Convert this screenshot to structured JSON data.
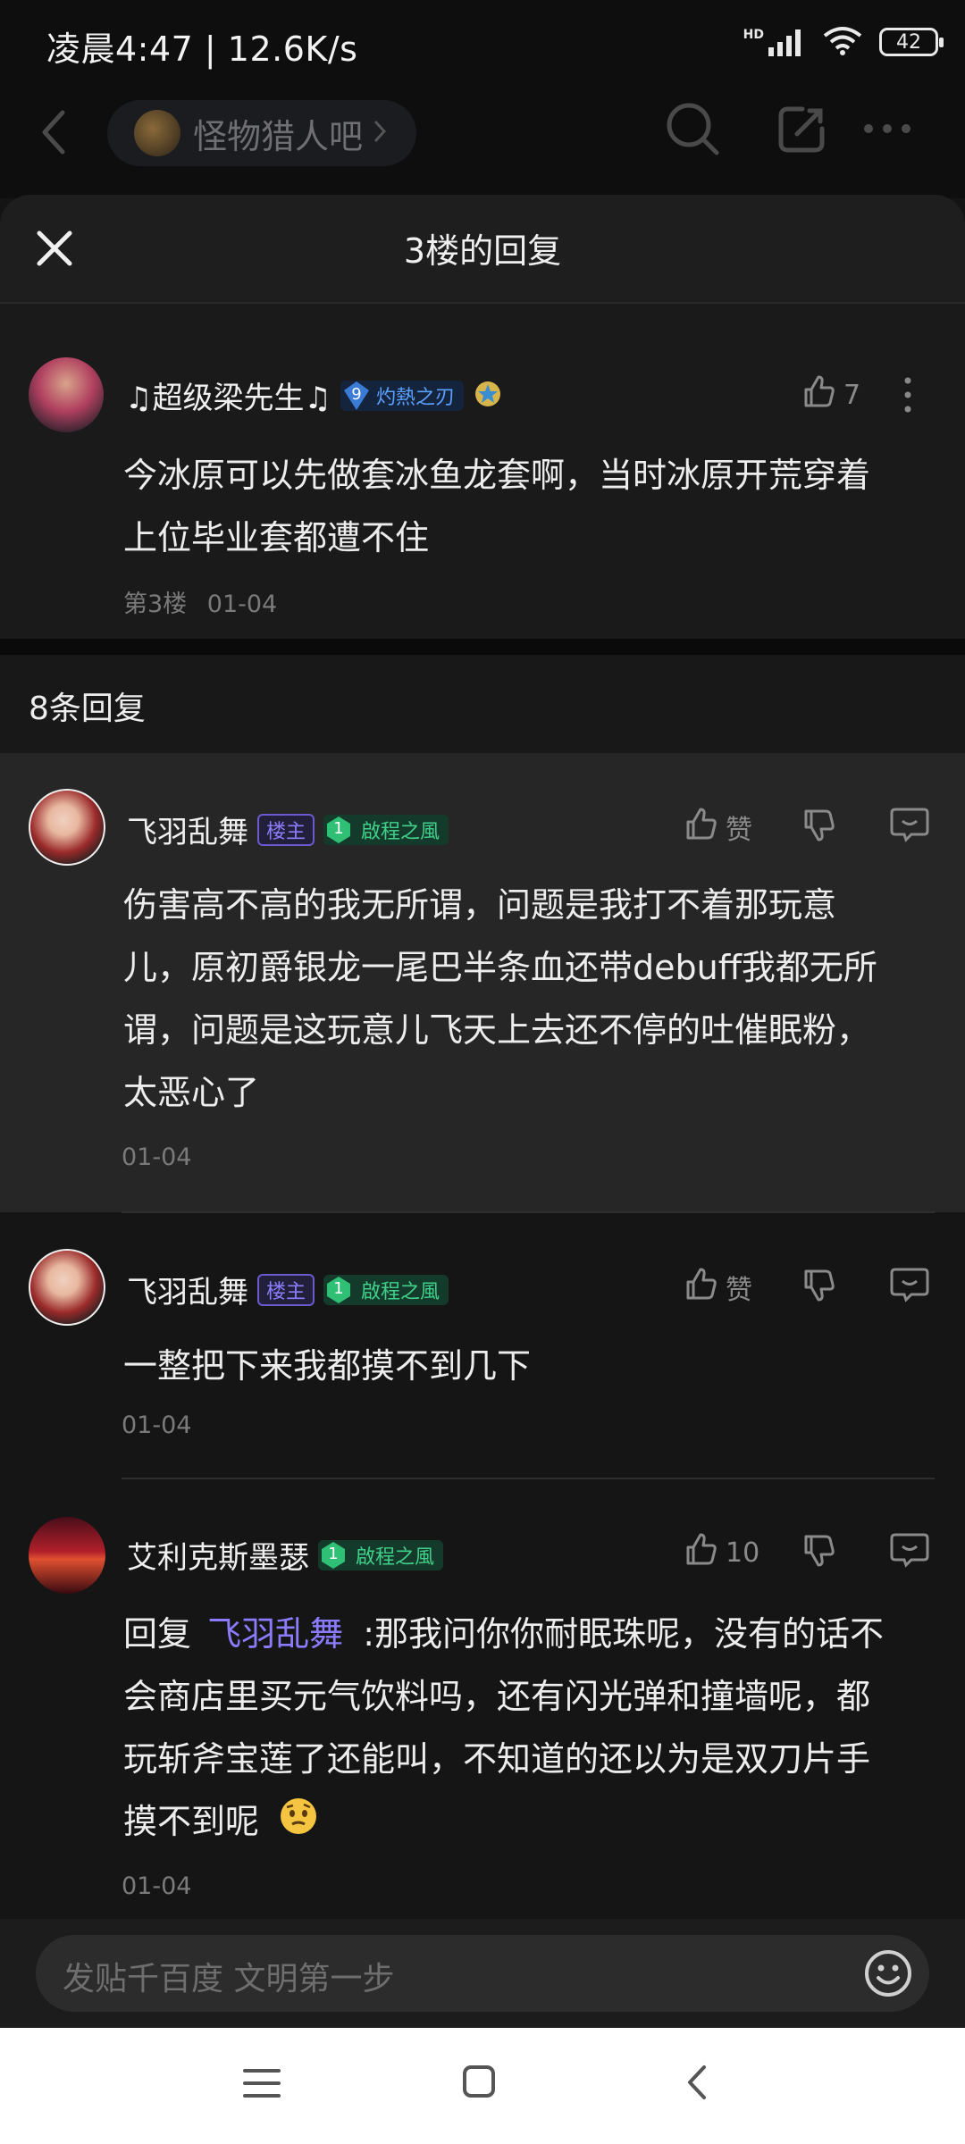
{
  "status": {
    "time_speed": "凌晨4:47 | 12.6K/s",
    "network": "HD",
    "battery": "42"
  },
  "topnav": {
    "forum_name": "怪物猎人吧"
  },
  "sheet": {
    "title": "3楼的回复"
  },
  "main_post": {
    "username": "♫超级梁先生♫",
    "level": "9",
    "level_title": "灼熱之刃",
    "likes": "7",
    "text_line1": "今冰原可以先做套冰鱼龙套啊，当时冰原开荒穿着",
    "text_line2": "上位毕业套都遭不住",
    "floor": "第3楼",
    "date": "01-04"
  },
  "replies_count": "8条回复",
  "replies": [
    {
      "username": "飞羽乱舞",
      "tag": "楼主",
      "level": "1",
      "level_title": "啟程之風",
      "like_label": "赞",
      "lines": [
        "伤害高不高的我无所谓，问题是我打不着那玩意",
        "儿，原初爵银龙一尾巴半条血还带debuff我都无所",
        "谓，问题是这玩意儿飞天上去还不停的吐催眠粉，",
        "太恶心了"
      ],
      "date": "01-04"
    },
    {
      "username": "飞羽乱舞",
      "tag": "楼主",
      "level": "1",
      "level_title": "啟程之風",
      "like_label": "赞",
      "lines": [
        "一整把下来我都摸不到几下"
      ],
      "date": "01-04"
    },
    {
      "username": "艾利克斯墨瑟",
      "level": "1",
      "level_title": "啟程之風",
      "like_label": "10",
      "reply_prefix": "回复 ",
      "mention": "飞羽乱舞",
      "lines": [
        ":那我问你你耐眠珠呢，没有的话不",
        "会商店里买元气饮料吗，还有闪光弹和撞墙呢，都",
        "玩斩斧宝莲了还能叫，不知道的还以为是双刀片手",
        "摸不到呢"
      ],
      "date": "01-04"
    }
  ],
  "input": {
    "placeholder": "发贴千百度 文明第一步"
  },
  "colors": {
    "background": "#141414",
    "highlight": "#262626",
    "accent_purple": "#8b7cff",
    "level_green": "#40d089",
    "level_blue": "#3a7bd5"
  }
}
